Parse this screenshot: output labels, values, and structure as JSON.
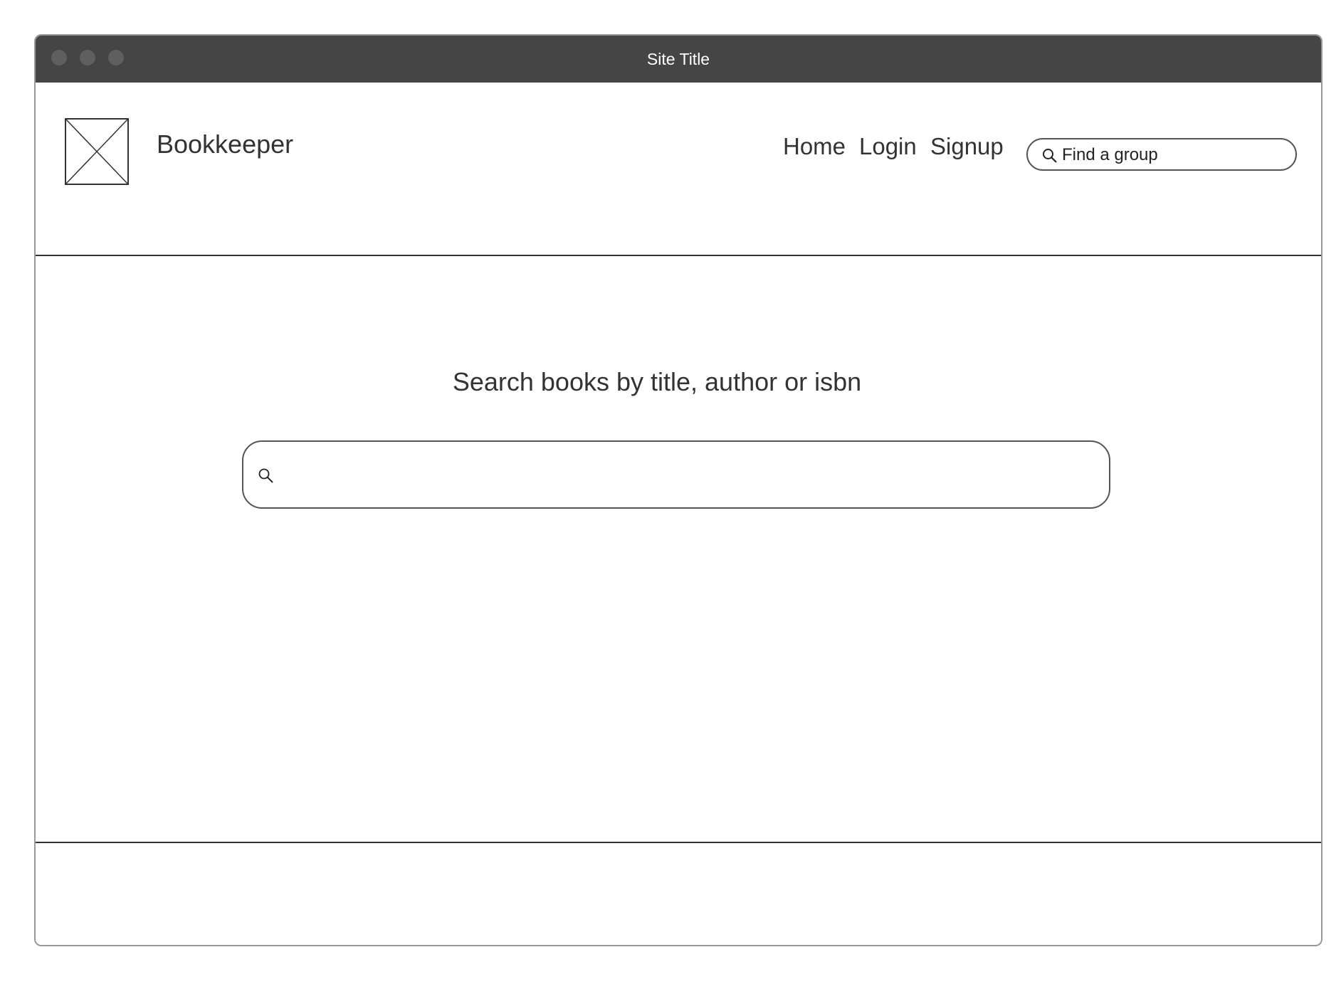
{
  "window": {
    "title": "Site Title"
  },
  "header": {
    "brand": "Bookkeeper",
    "nav": {
      "home": "Home",
      "login": "Login",
      "signup": "Signup"
    },
    "group_search": {
      "placeholder": "Find a group",
      "icon": "search-icon"
    }
  },
  "main": {
    "heading": "Search books by title, author or isbn",
    "book_search": {
      "value": "",
      "icon": "search-icon"
    }
  },
  "colors": {
    "titlebar": "#454545",
    "titlebar_text": "#ffffff",
    "text": "#333333",
    "border": "#555555"
  }
}
